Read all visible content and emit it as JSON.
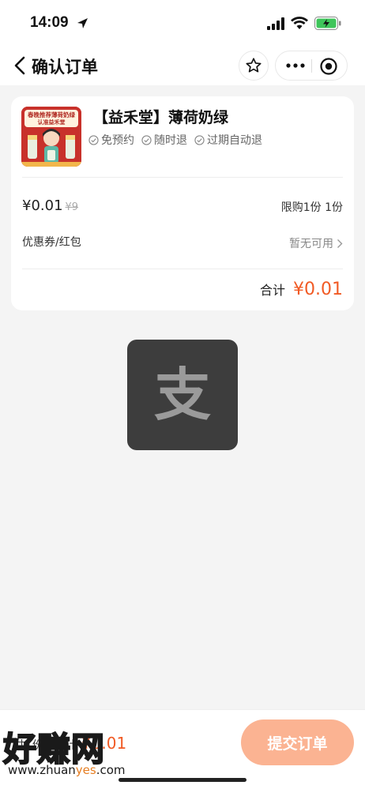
{
  "status_bar": {
    "time": "14:09"
  },
  "nav": {
    "title": "确认订单"
  },
  "order": {
    "product_title": "【益禾堂】薄荷奶绿",
    "image_caption_top": "春晚推荐薄荷奶绿",
    "image_caption_bottom": "认准益禾堂",
    "tags": [
      "免预约",
      "随时退",
      "过期自动退"
    ],
    "price_current": "¥0.01",
    "price_original": "¥9",
    "limit_text": "限购1份  1份",
    "coupon_label": "优惠券/红包",
    "coupon_value": "暂无可用",
    "total_label": "合计",
    "total_value": "¥0.01"
  },
  "alipay_logo": {
    "glyph": "支"
  },
  "bottom_bar": {
    "total_prefix": "共1份，合计",
    "total_amount": "¥0.01",
    "submit_label": "提交订单"
  },
  "watermark": {
    "main": "好赚网",
    "url_prefix": "www.zhuan",
    "url_accent": "yes",
    "url_suffix": ".com"
  },
  "colors": {
    "accent": "#f15a24",
    "submit_bg": "#fbb392",
    "logo_bg": "#3d3d3d"
  }
}
